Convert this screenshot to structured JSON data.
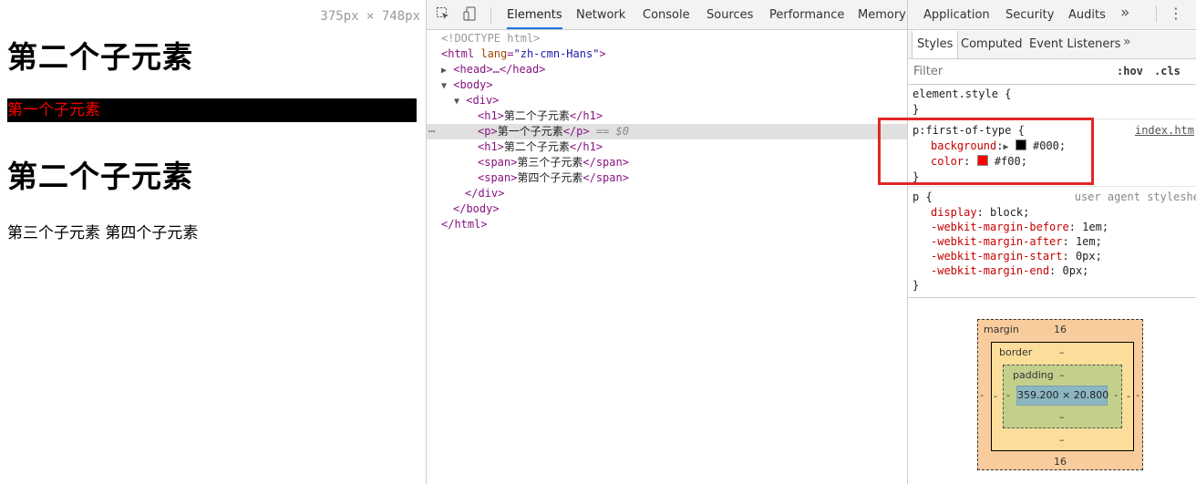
{
  "preview": {
    "viewport_size": "375px × 748px",
    "h1_first": "第二个子元素",
    "p_text": "第一个子元素",
    "h1_second": "第二个子元素",
    "span_line": "第三个子元素 第四个子元素"
  },
  "devtools": {
    "tabs": [
      "Elements",
      "Network",
      "Console",
      "Sources",
      "Performance",
      "Memory",
      "Application",
      "Security",
      "Audits"
    ],
    "active_tab": "Elements",
    "dom": {
      "doctype": "<!DOCTYPE html>",
      "html_open": "<html",
      "html_attr_name": "lang",
      "html_attr_value": "\"zh-cmn-Hans\"",
      "head": "<head>…</head>",
      "body_open": "<body>",
      "div_open": "<div>",
      "h1_1_text": "第二个子元素",
      "p_text": "第一个子元素",
      "eq_ref": "== $0",
      "h1_2_text": "第二个子元素",
      "span_1_text": "第三个子元素",
      "span_2_text": "第四个子元素",
      "div_close": "</div>",
      "body_close": "</body>",
      "html_close": "</html>"
    },
    "styles_tabs": [
      "Styles",
      "Computed",
      "Event Listeners"
    ],
    "active_styles_tab": "Styles",
    "filter_placeholder": "Filter",
    "hov": ":hov",
    "cls": ".cls",
    "element_style": "element.style {",
    "rule_selector": "p:first-of-type {",
    "rule_source": "index.htm",
    "rule_background_prop": "background",
    "rule_background_val": "#000;",
    "rule_color_prop": "color",
    "rule_color_val": "#f00;",
    "ua_selector": "p {",
    "ua_source": "user agent styleshe",
    "ua_props": [
      {
        "prop": "display",
        "val": "block;"
      },
      {
        "prop": "-webkit-margin-before",
        "val": "1em;"
      },
      {
        "prop": "-webkit-margin-after",
        "val": "1em;"
      },
      {
        "prop": "-webkit-margin-start",
        "val": "0px;"
      },
      {
        "prop": "-webkit-margin-end",
        "val": "0px;"
      }
    ],
    "close_brace": "}",
    "box_model": {
      "margin_label": "margin",
      "margin_top": "16",
      "margin_bottom": "16",
      "margin_left": "-",
      "margin_right": "-",
      "border_label": "border",
      "border_top": "–",
      "border_bottom": "–",
      "border_left": "-",
      "border_right": "-",
      "padding_label": "padding",
      "padding_top": "–",
      "padding_bottom": "–",
      "padding_left": "-",
      "padding_right": "-",
      "content": "359.200 × 20.800"
    }
  },
  "colors": {
    "p_background": "#000000",
    "p_color": "#ff0000",
    "highlight": "#e12727",
    "active_tab": "#1a73e8"
  }
}
